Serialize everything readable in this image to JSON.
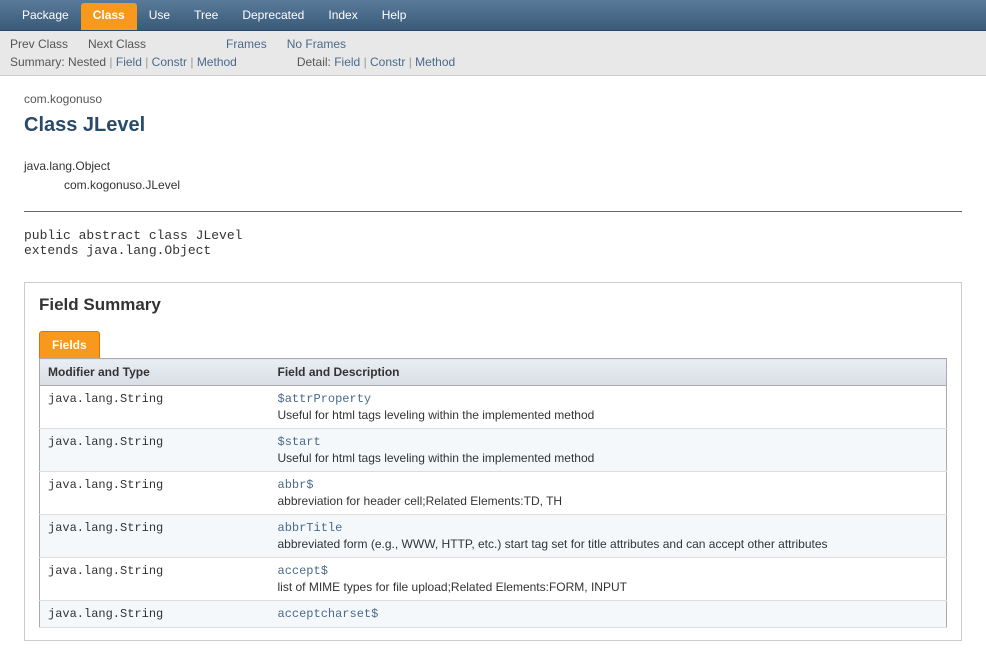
{
  "topnav": {
    "items": [
      {
        "label": "Package",
        "active": false
      },
      {
        "label": "Class",
        "active": true
      },
      {
        "label": "Use",
        "active": false
      },
      {
        "label": "Tree",
        "active": false
      },
      {
        "label": "Deprecated",
        "active": false
      },
      {
        "label": "Index",
        "active": false
      },
      {
        "label": "Help",
        "active": false
      }
    ]
  },
  "subnav": {
    "prev": "Prev Class",
    "next": "Next Class",
    "frames": "Frames",
    "noframes": "No Frames",
    "summary_label": "Summary:",
    "summary_nested": "Nested",
    "summary_field": "Field",
    "summary_constr": "Constr",
    "summary_method": "Method",
    "detail_label": "Detail:",
    "detail_field": "Field",
    "detail_constr": "Constr",
    "detail_method": "Method"
  },
  "package_name": "com.kogonuso",
  "class_title": "Class JLevel",
  "inheritance": {
    "root": "java.lang.Object",
    "child": "com.kogonuso.JLevel"
  },
  "signature": "public abstract class JLevel\nextends java.lang.Object",
  "field_summary": {
    "title": "Field Summary",
    "tab": "Fields",
    "col1": "Modifier and Type",
    "col2": "Field and Description",
    "rows": [
      {
        "type": "java.lang.String",
        "name": "$attrProperty",
        "desc": "Useful for html tags leveling within the implemented method"
      },
      {
        "type": "java.lang.String",
        "name": "$start",
        "desc": "Useful for html tags leveling within the implemented method"
      },
      {
        "type": "java.lang.String",
        "name": "abbr$",
        "desc": "abbreviation for header cell;Related Elements:TD, TH"
      },
      {
        "type": "java.lang.String",
        "name": "abbrTitle",
        "desc": "abbreviated form (e.g., WWW, HTTP, etc.) start tag set for title attributes and can accept other attributes"
      },
      {
        "type": "java.lang.String",
        "name": "accept$",
        "desc": "list of MIME types for file upload;Related Elements:FORM, INPUT"
      },
      {
        "type": "java.lang.String",
        "name": "acceptcharset$",
        "desc": ""
      }
    ]
  }
}
